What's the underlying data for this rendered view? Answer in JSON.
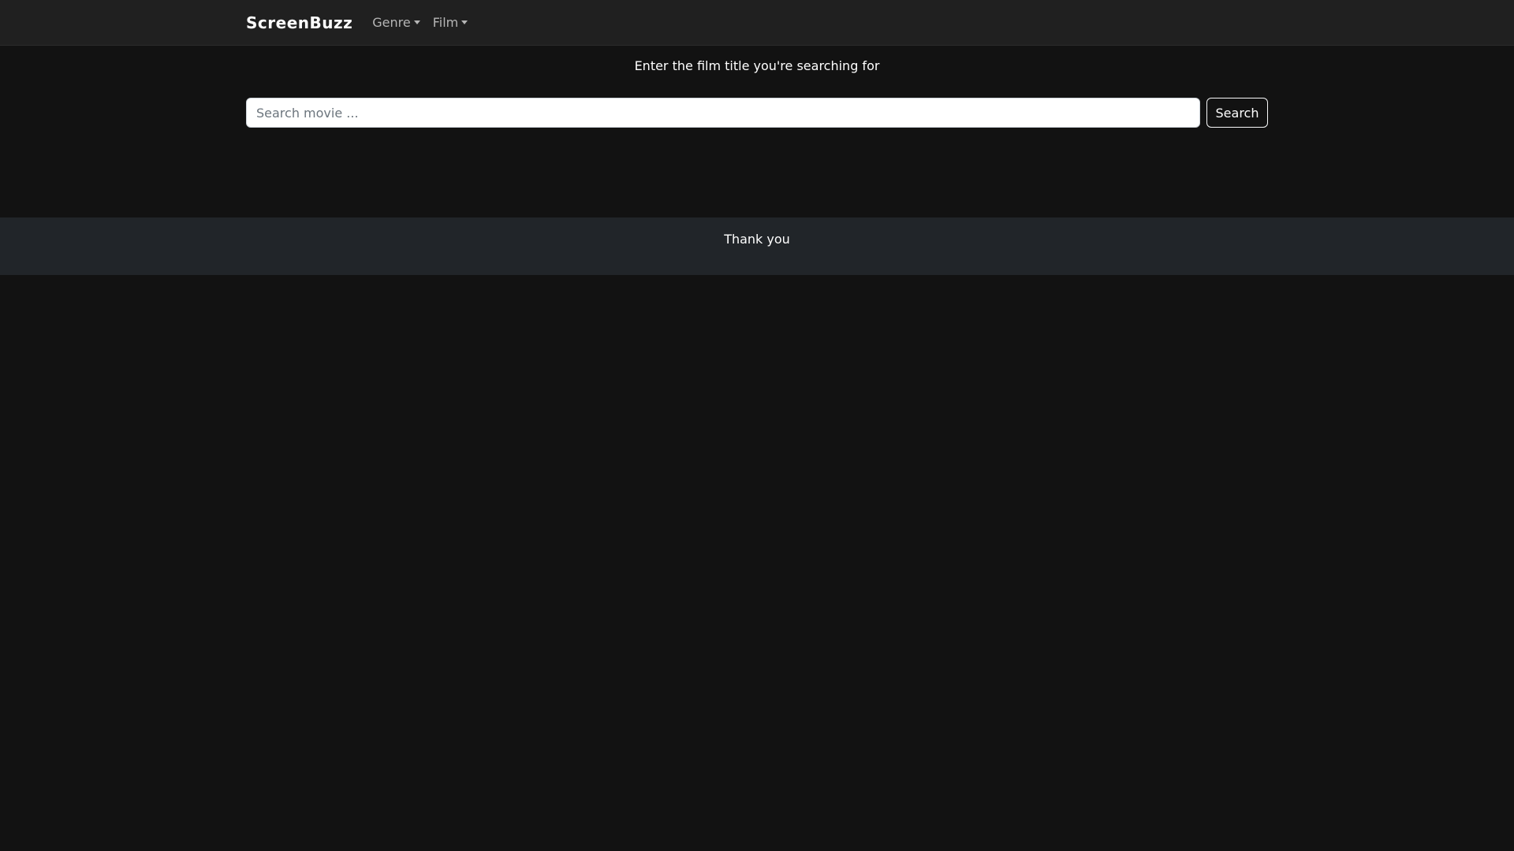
{
  "navbar": {
    "brand": "ScreenBuzz",
    "menus": [
      {
        "label": "Genre"
      },
      {
        "label": "Film"
      }
    ]
  },
  "main": {
    "prompt": "Enter the film title you're searching for",
    "search": {
      "placeholder": "Search movie ...",
      "value": "",
      "button_label": "Search"
    }
  },
  "footer": {
    "text": "Thank you"
  },
  "colors": {
    "page_background": "#121212",
    "navbar_background": "#202020",
    "footer_background": "#212529"
  }
}
